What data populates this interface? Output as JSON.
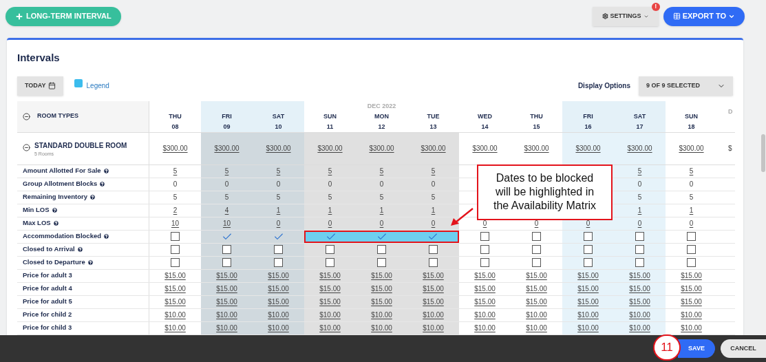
{
  "top_bar": {
    "new_button": "LONG-TERM INTERVAL",
    "settings": {
      "label": "SETTINGS",
      "alert": "!"
    },
    "export_button": "EXPORT TO"
  },
  "card": {
    "title": "Intervals",
    "today_button": "TODAY",
    "legend": {
      "label": "Legend",
      "color": "#3bbced"
    },
    "display_options": {
      "label": "Display Options",
      "value": "9 OF 9 SELECTED"
    }
  },
  "table": {
    "corner_label": "ROOM TYPES",
    "days": [
      {
        "dow": "THU",
        "date": "08",
        "weekend": false,
        "selected": false
      },
      {
        "dow": "FRI",
        "date": "09",
        "weekend": true,
        "selected": true
      },
      {
        "dow": "SAT",
        "date": "10",
        "weekend": true,
        "selected": true
      },
      {
        "dow": "SUN",
        "date": "11",
        "weekend": false,
        "selected": true
      },
      {
        "dow": "MON",
        "date": "12",
        "weekend": false,
        "selected": true,
        "month": "DEC 2022"
      },
      {
        "dow": "TUE",
        "date": "13",
        "weekend": false,
        "selected": true
      },
      {
        "dow": "WED",
        "date": "14",
        "weekend": false,
        "selected": false
      },
      {
        "dow": "THU",
        "date": "15",
        "weekend": false,
        "selected": false
      },
      {
        "dow": "FRI",
        "date": "16",
        "weekend": true,
        "selected": false
      },
      {
        "dow": "SAT",
        "date": "17",
        "weekend": true,
        "selected": false
      },
      {
        "dow": "SUN",
        "date": "18",
        "weekend": false,
        "selected": false
      }
    ],
    "partial_column": {
      "month": "D",
      "price": "$"
    },
    "room": {
      "name": "STANDARD DOUBLE ROOM",
      "subtitle": "5 Rooms",
      "prices": [
        "$300.00",
        "$300.00",
        "$300.00",
        "$300.00",
        "$300.00",
        "$300.00",
        "$300.00",
        "$300.00",
        "$300.00",
        "$300.00",
        "$300.00"
      ]
    },
    "rows": [
      {
        "label": "Amount Allotted For Sale",
        "help": true,
        "kind": "link",
        "cells": [
          "5",
          "5",
          "5",
          "5",
          "5",
          "5",
          null,
          null,
          null,
          "5",
          "5"
        ]
      },
      {
        "label": "Group Allotment Blocks",
        "help": true,
        "kind": "plain",
        "cells": [
          "0",
          "0",
          "0",
          "0",
          "0",
          "0",
          null,
          null,
          null,
          "0",
          "0"
        ]
      },
      {
        "label": "Remaining Inventory",
        "help": true,
        "kind": "plain",
        "cells": [
          "5",
          "5",
          "5",
          "5",
          "5",
          "5",
          null,
          null,
          null,
          "5",
          "5"
        ]
      },
      {
        "label": "Min LOS",
        "help": true,
        "kind": "link",
        "cells": [
          "2",
          "4",
          "1",
          "1",
          "1",
          "1",
          null,
          null,
          null,
          "1",
          "1"
        ]
      },
      {
        "label": "Max LOS",
        "help": true,
        "kind": "link",
        "cells": [
          "10",
          "10",
          "0",
          "0",
          "0",
          "0",
          "0",
          "0",
          "0",
          "0",
          "0"
        ]
      },
      {
        "label": "Accommodation Blocked",
        "help": true,
        "kind": "checkbox",
        "cells": [
          {
            "checked": false,
            "highlighted": false
          },
          {
            "checked": true,
            "highlighted": false
          },
          {
            "checked": true,
            "highlighted": false
          },
          {
            "checked": true,
            "highlighted": true
          },
          {
            "checked": true,
            "highlighted": true
          },
          {
            "checked": true,
            "highlighted": true
          },
          {
            "checked": false,
            "highlighted": false
          },
          {
            "checked": false,
            "highlighted": false
          },
          {
            "checked": false,
            "highlighted": false
          },
          {
            "checked": false,
            "highlighted": false
          },
          {
            "checked": false,
            "highlighted": false
          }
        ]
      },
      {
        "label": "Closed to Arrival",
        "help": true,
        "kind": "checkbox",
        "cells": [
          {
            "checked": false,
            "highlighted": false
          },
          {
            "checked": false,
            "highlighted": false
          },
          {
            "checked": false,
            "highlighted": false
          },
          {
            "checked": false,
            "highlighted": false
          },
          {
            "checked": false,
            "highlighted": false
          },
          {
            "checked": false,
            "highlighted": false
          },
          {
            "checked": false,
            "highlighted": false
          },
          {
            "checked": false,
            "highlighted": false
          },
          {
            "checked": false,
            "highlighted": false
          },
          {
            "checked": false,
            "highlighted": false
          },
          {
            "checked": false,
            "highlighted": false
          }
        ]
      },
      {
        "label": "Closed to Departure",
        "help": true,
        "kind": "checkbox",
        "cells": [
          {
            "checked": false,
            "highlighted": false
          },
          {
            "checked": false,
            "highlighted": false
          },
          {
            "checked": false,
            "highlighted": false
          },
          {
            "checked": false,
            "highlighted": false
          },
          {
            "checked": false,
            "highlighted": false
          },
          {
            "checked": false,
            "highlighted": false
          },
          {
            "checked": false,
            "highlighted": false
          },
          {
            "checked": false,
            "highlighted": false
          },
          {
            "checked": false,
            "highlighted": false
          },
          {
            "checked": false,
            "highlighted": false
          },
          {
            "checked": false,
            "highlighted": false
          }
        ]
      },
      {
        "label": "Price for adult 3",
        "help": false,
        "kind": "link",
        "cells": [
          "$15.00",
          "$15.00",
          "$15.00",
          "$15.00",
          "$15.00",
          "$15.00",
          "$15.00",
          "$15.00",
          "$15.00",
          "$15.00",
          "$15.00"
        ]
      },
      {
        "label": "Price for adult 4",
        "help": false,
        "kind": "link",
        "cells": [
          "$15.00",
          "$15.00",
          "$15.00",
          "$15.00",
          "$15.00",
          "$15.00",
          "$15.00",
          "$15.00",
          "$15.00",
          "$15.00",
          "$15.00"
        ]
      },
      {
        "label": "Price for adult 5",
        "help": false,
        "kind": "link",
        "cells": [
          "$15.00",
          "$15.00",
          "$15.00",
          "$15.00",
          "$15.00",
          "$15.00",
          "$15.00",
          "$15.00",
          "$15.00",
          "$15.00",
          "$15.00"
        ]
      },
      {
        "label": "Price for child 2",
        "help": false,
        "kind": "link",
        "cells": [
          "$10.00",
          "$10.00",
          "$10.00",
          "$10.00",
          "$10.00",
          "$10.00",
          "$10.00",
          "$10.00",
          "$10.00",
          "$10.00",
          "$10.00"
        ]
      },
      {
        "label": "Price for child 3",
        "help": false,
        "kind": "link",
        "cells": [
          "$10.00",
          "$10.00",
          "$10.00",
          "$10.00",
          "$10.00",
          "$10.00",
          "$10.00",
          "$10.00",
          "$10.00",
          "$10.00",
          "$10.00"
        ]
      }
    ]
  },
  "callout": {
    "text": "Dates to be blocked will be highlighted in the Availability Matrix"
  },
  "footer": {
    "step": "11",
    "save": "SAVE",
    "cancel": "CANCEL"
  }
}
